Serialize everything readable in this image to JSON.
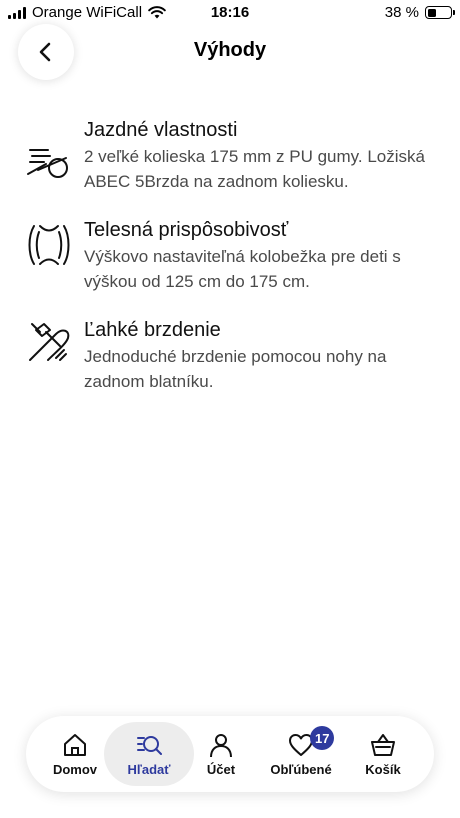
{
  "status_bar": {
    "carrier": "Orange WiFiCall",
    "time": "18:16",
    "battery_percent": "38 %",
    "battery_level": 0.38
  },
  "header": {
    "title": "Výhody",
    "back_icon": "chevron-left-icon"
  },
  "benefits": [
    {
      "icon": "ride-wheel-icon",
      "title": "Jazdné vlastnosti",
      "text": "2 veľké kolieska 175 mm z PU gumy. Ložiská ABEC 5Brzda na zadnom koliesku."
    },
    {
      "icon": "adjustable-height-icon",
      "title": "Telesná prispôsobivosť",
      "text": "Výškovo nastaviteľná kolobežka pre deti s výškou od 125 cm do 175 cm."
    },
    {
      "icon": "foot-brake-icon",
      "title": "Ľahké brzdenie",
      "text": "Jednoduché brzdenie pomocou nohy na zadnom blatníku."
    }
  ],
  "tab_bar": {
    "tabs": [
      {
        "label": "Domov",
        "icon": "home-icon",
        "active": false
      },
      {
        "label": "Hľadať",
        "icon": "search-icon",
        "active": true
      },
      {
        "label": "Účet",
        "icon": "user-icon",
        "active": false
      },
      {
        "label": "Obľúbené",
        "icon": "heart-icon",
        "active": false,
        "badge": "17"
      },
      {
        "label": "Košík",
        "icon": "basket-icon",
        "active": false
      }
    ],
    "accent_color": "#2e3a9e"
  }
}
